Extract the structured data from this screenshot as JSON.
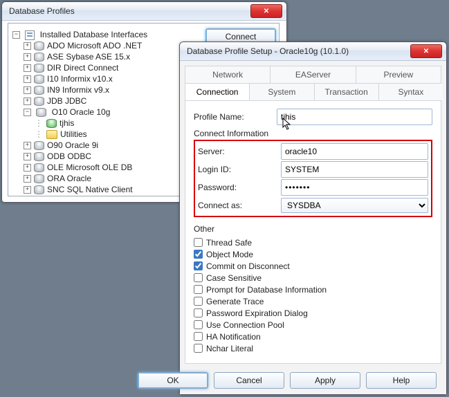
{
  "profiles_window": {
    "title": "Database Profiles",
    "connect_btn": "Connect",
    "root": "Installed Database Interfaces",
    "items": [
      {
        "label": "ADO Microsoft ADO .NET"
      },
      {
        "label": "ASE Sybase ASE 15.x"
      },
      {
        "label": "DIR Direct Connect"
      },
      {
        "label": "I10 Informix v10.x"
      },
      {
        "label": "IN9 Informix v9.x"
      },
      {
        "label": "JDB JDBC"
      }
    ],
    "oracle10g": {
      "label": "O10 Oracle 10g",
      "children": [
        {
          "label": "tjhis",
          "icon": "green"
        },
        {
          "label": "Utilities",
          "icon": "folder"
        }
      ]
    },
    "rest": [
      {
        "label": "O90 Oracle 9i"
      },
      {
        "label": "ODB ODBC"
      },
      {
        "label": "OLE Microsoft OLE DB"
      },
      {
        "label": "ORA Oracle"
      },
      {
        "label": "SNC SQL Native Client"
      }
    ]
  },
  "setup_window": {
    "title": "Database Profile Setup - Oracle10g (10.1.0)",
    "tabs_back": [
      "Network",
      "EAServer",
      "Preview"
    ],
    "tabs_front": [
      "Connection",
      "System",
      "Transaction",
      "Syntax"
    ],
    "active_tab": "Connection",
    "labels": {
      "profile_name": "Profile Name:",
      "connect_info": "Connect Information",
      "server": "Server:",
      "login": "Login ID:",
      "password": "Password:",
      "connect_as": "Connect as:",
      "other": "Other"
    },
    "values": {
      "profile_name": "tjhis",
      "server": "oracle10",
      "login": "SYSTEM",
      "password": "•••••••",
      "connect_as": "SYSDBA"
    },
    "checks": [
      {
        "label": "Thread Safe",
        "checked": false
      },
      {
        "label": "Object Mode",
        "checked": true
      },
      {
        "label": "Commit on Disconnect",
        "checked": true
      },
      {
        "label": "Case Sensitive",
        "checked": false
      },
      {
        "label": "Prompt for Database Information",
        "checked": false
      },
      {
        "label": "Generate Trace",
        "checked": false
      },
      {
        "label": "Password Expiration Dialog",
        "checked": false
      },
      {
        "label": "Use Connection Pool",
        "checked": false
      },
      {
        "label": "HA Notification",
        "checked": false
      },
      {
        "label": "Nchar Literal",
        "checked": false
      }
    ],
    "buttons": {
      "ok": "OK",
      "cancel": "Cancel",
      "apply": "Apply",
      "help": "Help"
    }
  }
}
